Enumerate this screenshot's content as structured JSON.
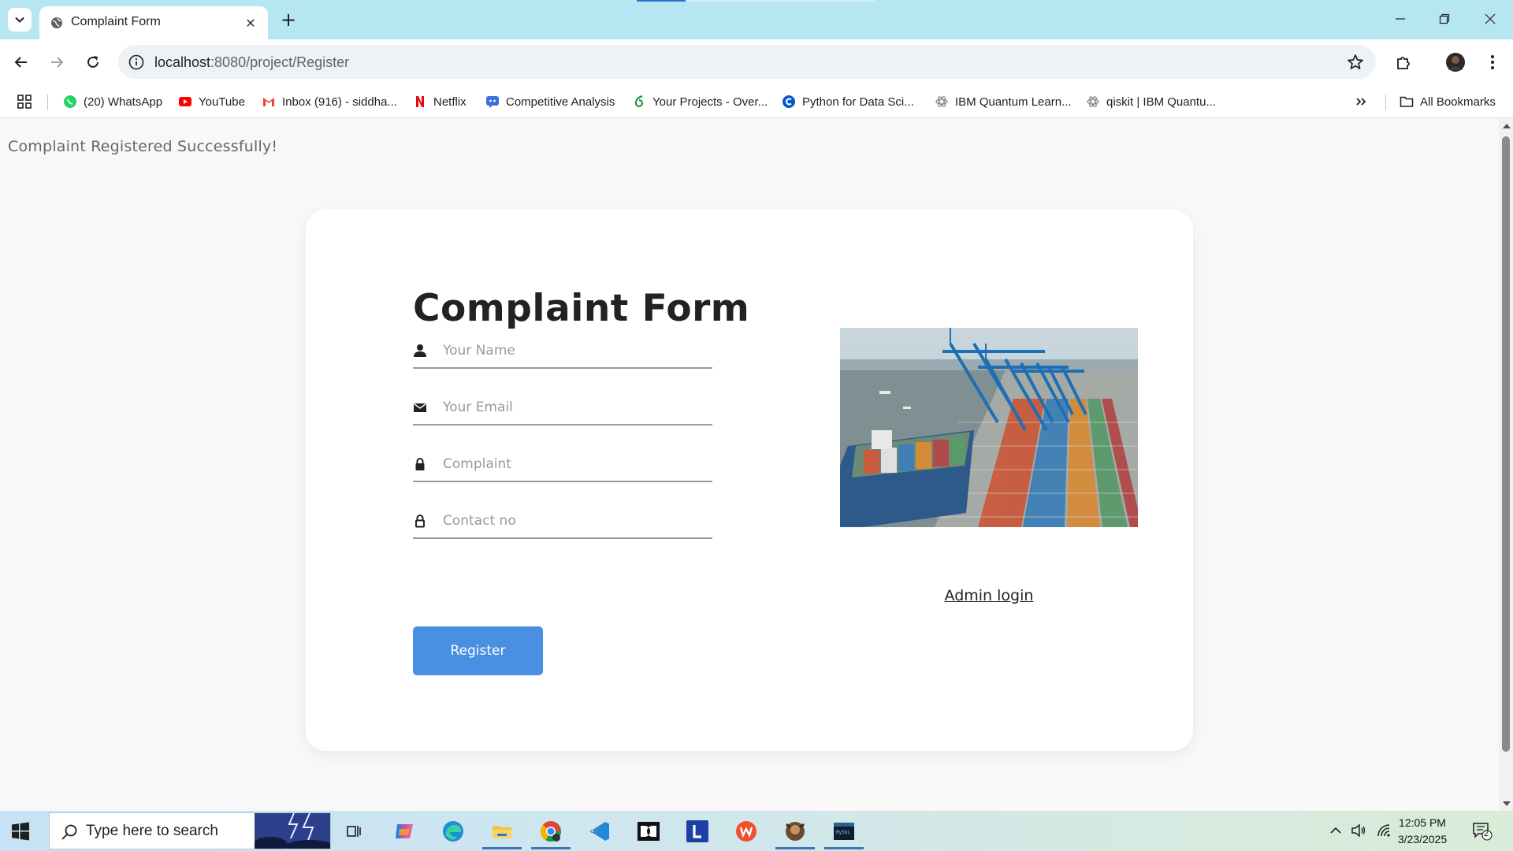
{
  "browser": {
    "tab_title": "Complaint Form",
    "url_host": "localhost",
    "url_path": ":8080/project/Register",
    "bookmarks": [
      {
        "label": "(20) WhatsApp",
        "icon": "whatsapp-icon"
      },
      {
        "label": "YouTube",
        "icon": "youtube-icon"
      },
      {
        "label": "Inbox (916) - siddha...",
        "icon": "gmail-icon"
      },
      {
        "label": "Netflix",
        "icon": "netflix-icon"
      },
      {
        "label": "Competitive Analysis",
        "icon": "chat-bot-icon"
      },
      {
        "label": "Your Projects - Over...",
        "icon": "overleaf-icon"
      },
      {
        "label": "Python for Data Sci...",
        "icon": "coursera-icon"
      },
      {
        "label": "IBM Quantum Learn...",
        "icon": "ibm-quantum-icon"
      },
      {
        "label": "qiskit | IBM Quantu...",
        "icon": "ibm-quantum-icon"
      }
    ],
    "all_bookmarks_label": "All Bookmarks"
  },
  "page": {
    "success_message": "Complaint Registered Successfully!",
    "form": {
      "title": "Complaint Form",
      "fields": [
        {
          "placeholder": "Your Name",
          "value": "",
          "icon": "person-icon"
        },
        {
          "placeholder": "Your Email",
          "value": "",
          "icon": "mail-icon"
        },
        {
          "placeholder": "Complaint",
          "value": "",
          "icon": "lock-icon"
        },
        {
          "placeholder": "Contact no",
          "value": "",
          "icon": "lock-outline-icon"
        }
      ],
      "register_label": "Register"
    },
    "admin_link": "Admin login",
    "image_icon": "container-port-image"
  },
  "taskbar": {
    "search_placeholder": "Type here to search",
    "time": "12:05 PM",
    "date": "3/23/2025",
    "notification_count": "2",
    "apps": [
      "copilot-icon",
      "edge-icon",
      "file-explorer-icon",
      "chrome-icon",
      "vscode-icon",
      "dolby-icon",
      "l-app-icon",
      "wps-icon",
      "game-app-icon",
      "mysql-icon"
    ]
  },
  "colors": {
    "tabstrip": "#b7e6f3",
    "button": "#4a90e2",
    "page_bg": "#f8f8f8",
    "card_bg": "#ffffff",
    "title": "#222222"
  }
}
